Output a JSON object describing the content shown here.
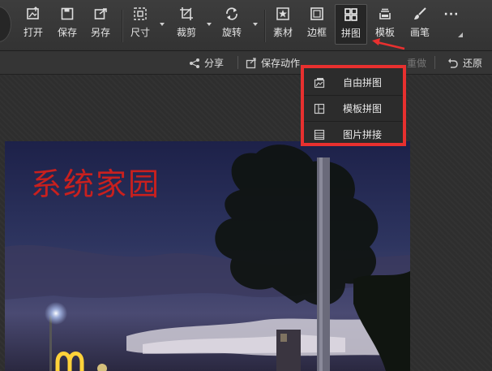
{
  "toolbar": {
    "open": "打开",
    "save": "保存",
    "save_as": "另存",
    "size": "尺寸",
    "crop": "裁剪",
    "rotate": "旋转",
    "material": "素材",
    "border": "边框",
    "collage": "拼图",
    "template": "模板",
    "brush": "画笔",
    "more": "···"
  },
  "subbar": {
    "share": "分享",
    "save_action": "保存动作",
    "redo": "重做",
    "restore": "还原"
  },
  "collage_menu": {
    "items": [
      {
        "label": "自由拼图",
        "icon": "free-collage-icon"
      },
      {
        "label": "模板拼图",
        "icon": "template-collage-icon"
      },
      {
        "label": "图片拼接",
        "icon": "image-join-icon"
      }
    ]
  },
  "photo": {
    "watermark": "系统家园"
  },
  "colors": {
    "accent_red": "#e8302f",
    "watermark_red": "#c9201e",
    "toolbar_bg": "#3a3a3a"
  }
}
